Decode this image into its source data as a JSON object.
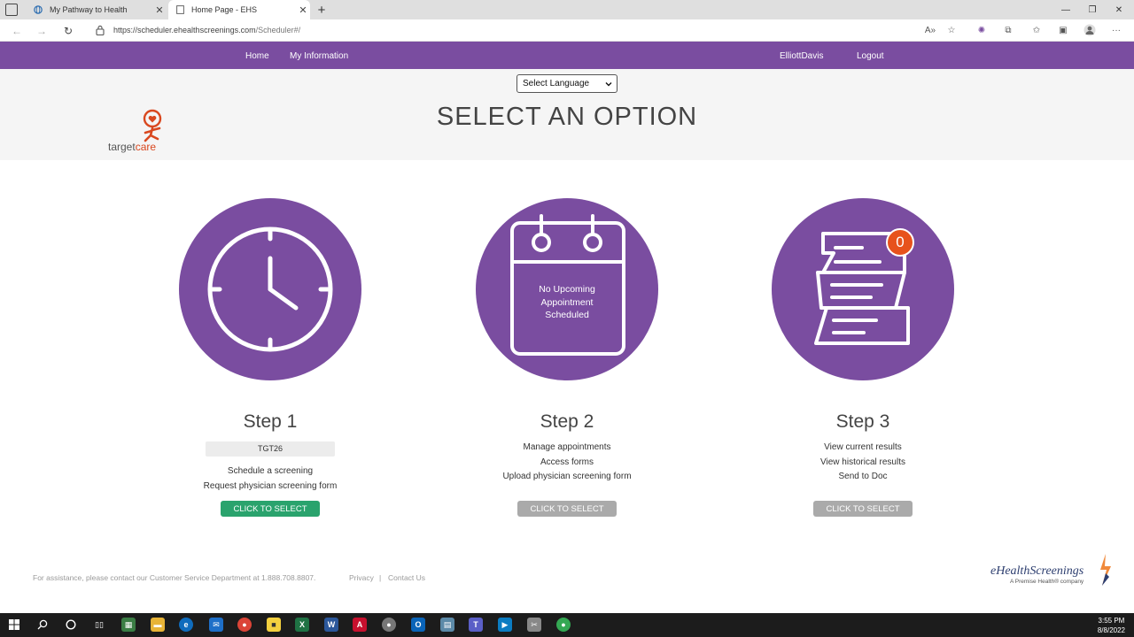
{
  "browser": {
    "tabs": [
      {
        "title": "My Pathway to Health",
        "active": false
      },
      {
        "title": "Home Page - EHS",
        "active": true
      }
    ],
    "url_host": "https://scheduler.ehealthscreenings.com",
    "url_path": "/Scheduler#/"
  },
  "nav": {
    "home": "Home",
    "my_information": "My Information",
    "user": "ElliottDavis",
    "logout": "Logout"
  },
  "header": {
    "language_select": "Select Language",
    "title": "SELECT AN OPTION",
    "logo_target": "target",
    "logo_care": "care"
  },
  "steps": [
    {
      "title": "Step 1",
      "promo_code": "TGT26",
      "lines": [
        "Schedule a screening",
        "Request physician screening form"
      ],
      "button": "CLICK TO SELECT",
      "enabled": true
    },
    {
      "title": "Step 2",
      "calendar_text": "No Upcoming Appointment Scheduled",
      "lines": [
        "Manage appointments",
        "Access forms",
        "Upload physician screening form"
      ],
      "button": "CLICK TO SELECT",
      "enabled": false
    },
    {
      "title": "Step 3",
      "badge": "0",
      "lines": [
        "View current results",
        "View historical results",
        "Send to Doc"
      ],
      "button": "CLICK TO SELECT",
      "enabled": false
    }
  ],
  "footer": {
    "assistance": "For assistance, please contact our Customer Service Department at 1.888.708.8807.",
    "privacy": "Privacy",
    "separator": "|",
    "contact": "Contact Us",
    "brand_e": "e",
    "brand_name": "HealthScreenings",
    "brand_sub": "A Premise Health® company"
  },
  "taskbar": {
    "time": "3:55 PM",
    "date": "8/8/2022"
  },
  "colors": {
    "brand_purple": "#7a4da0",
    "active_button": "#2aa36d",
    "disabled_button": "#aaaaaa",
    "badge": "#e7521c"
  }
}
